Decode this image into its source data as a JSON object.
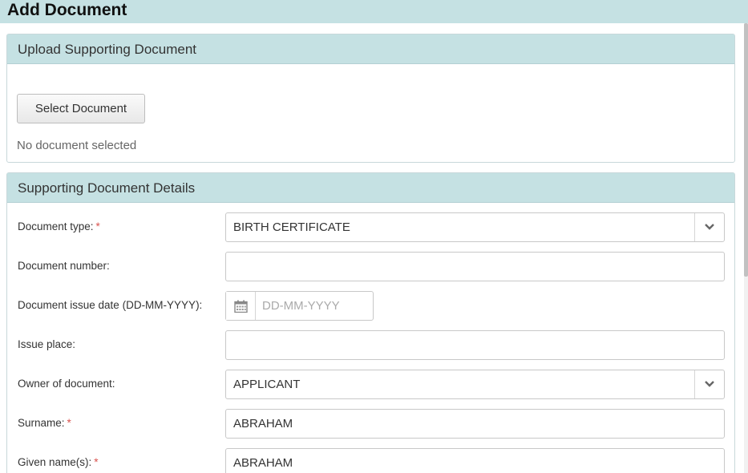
{
  "page": {
    "title": "Add Document"
  },
  "upload_panel": {
    "heading": "Upload Supporting Document",
    "select_button": "Select Document",
    "status": "No document selected"
  },
  "details_panel": {
    "heading": "Supporting Document Details",
    "required_marker": "*",
    "fields": {
      "document_type": {
        "label": "Document type:",
        "value": "BIRTH CERTIFICATE",
        "required": true
      },
      "document_number": {
        "label": "Document number:",
        "value": ""
      },
      "issue_date": {
        "label": "Document issue date (DD-MM-YYYY):",
        "value": "",
        "placeholder": "DD-MM-YYYY"
      },
      "issue_place": {
        "label": "Issue place:",
        "value": ""
      },
      "owner": {
        "label": "Owner of document:",
        "value": "APPLICANT"
      },
      "surname": {
        "label": "Surname:",
        "value": "ABRAHAM",
        "required": true
      },
      "given_names": {
        "label": "Given name(s):",
        "value": "ABRAHAM",
        "required": true
      }
    }
  },
  "icons": {
    "caret": "chevron-down-icon",
    "calendar": "calendar-icon"
  },
  "colors": {
    "header_bg": "#c5e1e3",
    "required": "#d9534f"
  }
}
